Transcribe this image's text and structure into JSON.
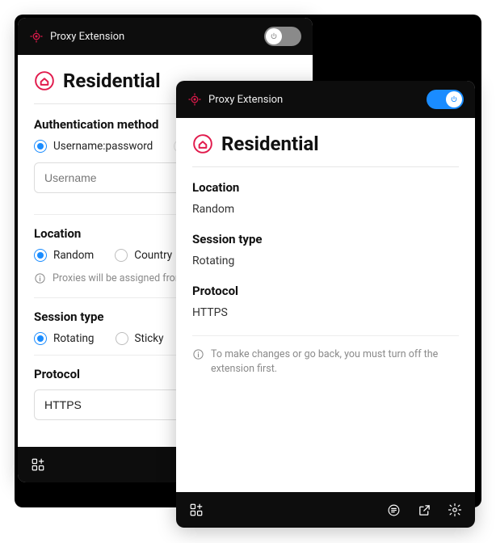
{
  "colors": {
    "brand": "#e11a4c",
    "accent": "#1a8cff",
    "header_bg": "#0d0d0d",
    "muted": "#8a8a8a"
  },
  "app": {
    "title": "Proxy Extension"
  },
  "page": {
    "title": "Residential"
  },
  "back_panel": {
    "toggle_on": false,
    "sections": {
      "auth": {
        "label": "Authentication method",
        "options": {
          "userpass": "Username:password"
        },
        "selected": "userpass",
        "username_placeholder": "Username"
      },
      "location": {
        "label": "Location",
        "options": {
          "random": "Random",
          "country": "Country"
        },
        "selected": "random",
        "hint": "Proxies will be assigned from ra"
      },
      "session": {
        "label": "Session type",
        "options": {
          "rotating": "Rotating",
          "sticky": "Sticky"
        },
        "selected": "rotating"
      },
      "protocol": {
        "label": "Protocol",
        "value": "HTTPS"
      }
    }
  },
  "front_panel": {
    "toggle_on": true,
    "location": {
      "label": "Location",
      "value": "Random"
    },
    "session": {
      "label": "Session type",
      "value": "Rotating"
    },
    "protocol": {
      "label": "Protocol",
      "value": "HTTPS"
    },
    "hint": "To make changes or go back, you must turn off the extension first."
  }
}
